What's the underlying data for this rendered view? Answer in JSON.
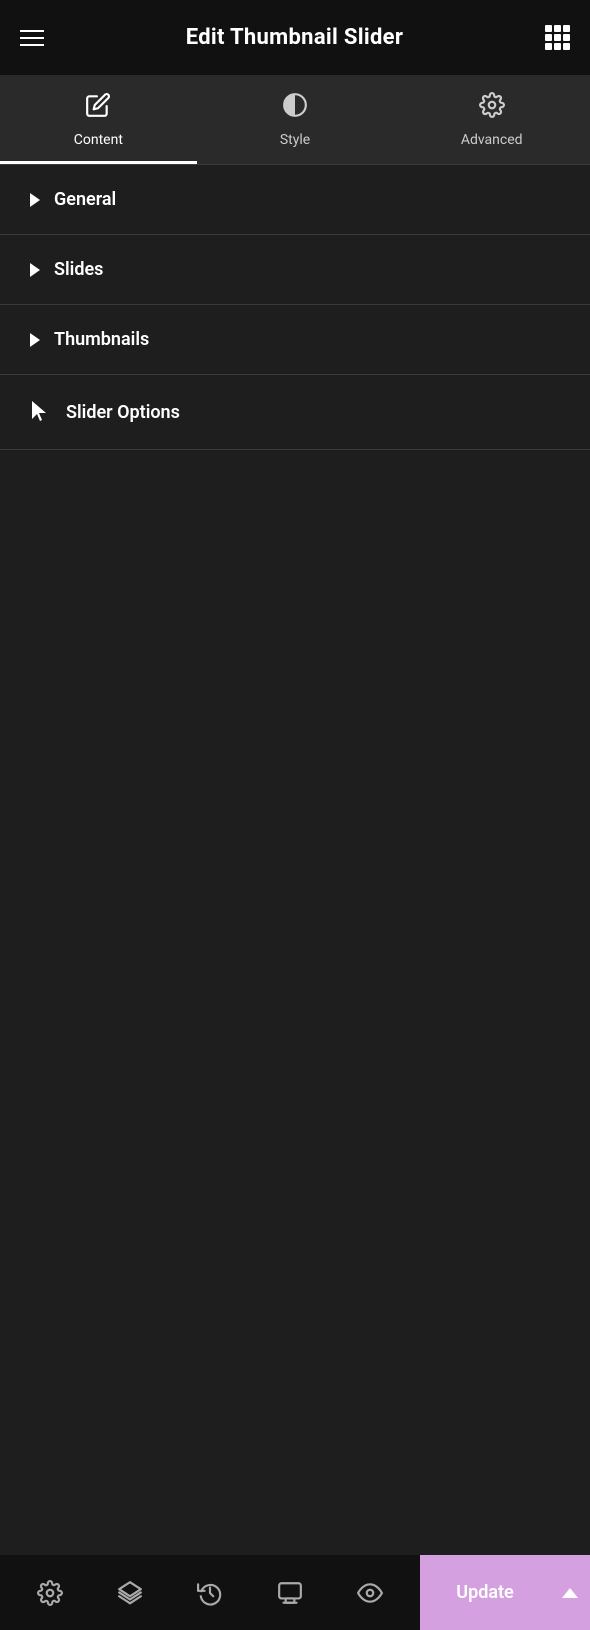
{
  "header": {
    "title": "Edit Thumbnail Slider",
    "hamburger_label": "menu",
    "grid_label": "apps"
  },
  "tabs": [
    {
      "id": "content",
      "label": "Content",
      "icon": "pencil",
      "active": true
    },
    {
      "id": "style",
      "label": "Style",
      "icon": "half-circle",
      "active": false
    },
    {
      "id": "advanced",
      "label": "Advanced",
      "icon": "gear",
      "active": false
    }
  ],
  "sections": [
    {
      "id": "general",
      "label": "General"
    },
    {
      "id": "slides",
      "label": "Slides"
    },
    {
      "id": "thumbnails",
      "label": "Thumbnails"
    },
    {
      "id": "slider-options",
      "label": "Slider Options"
    }
  ],
  "bottom_toolbar": {
    "icons": [
      {
        "id": "settings",
        "name": "settings-icon",
        "symbol": "⚙"
      },
      {
        "id": "layers",
        "name": "layers-icon",
        "symbol": "⧉"
      },
      {
        "id": "history",
        "name": "history-icon",
        "symbol": "↺"
      },
      {
        "id": "responsive",
        "name": "responsive-icon",
        "symbol": "⬜"
      },
      {
        "id": "preview",
        "name": "preview-icon",
        "symbol": "👁"
      }
    ],
    "update_label": "Update"
  }
}
